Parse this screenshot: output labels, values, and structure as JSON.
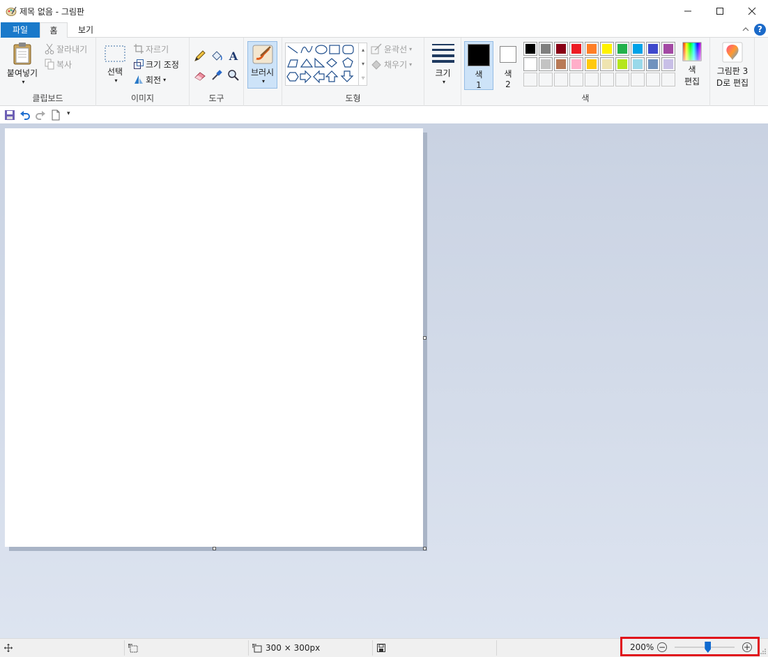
{
  "window": {
    "title": "제목 없음 - 그림판",
    "icon": "paint-palette-icon",
    "controls": [
      "minimize-icon",
      "maximize-icon",
      "close-icon"
    ]
  },
  "tabs": {
    "file": "파일",
    "home": "홈",
    "view": "보기",
    "help": "?"
  },
  "ribbon": {
    "clipboard": {
      "paste": "붙여넣기",
      "cut": "잘라내기",
      "copy": "복사",
      "label": "클립보드"
    },
    "image": {
      "select": "선택",
      "crop": "자르기",
      "resize": "크기 조정",
      "rotate": "회전",
      "label": "이미지"
    },
    "tools": {
      "label": "도구",
      "items": [
        "pencil-icon",
        "fill-bucket-icon",
        "text-icon",
        "eraser-icon",
        "color-picker-icon",
        "magnifier-icon"
      ]
    },
    "brushes": {
      "label": "브러시"
    },
    "shapes": {
      "outline": "윤곽선",
      "fill": "채우기",
      "label": "도형"
    },
    "size": {
      "label": "크기"
    },
    "colors": {
      "color1_label": "색",
      "color1_num": "1",
      "color2_label": "색",
      "color2_num": "2",
      "edit_line1": "색",
      "edit_line2": "편집",
      "label": "색",
      "color1": "#000000",
      "color2": "#ffffff",
      "palette_row1": [
        "#000000",
        "#7f7f7f",
        "#880015",
        "#ed1c24",
        "#ff7f27",
        "#fff200",
        "#22b14c",
        "#00a2e8",
        "#3f48cc",
        "#a349a4"
      ],
      "palette_row2": [
        "#ffffff",
        "#c3c3c3",
        "#b97a57",
        "#ffaec9",
        "#ffc90e",
        "#efe4b0",
        "#b5e61d",
        "#99d9ea",
        "#7092be",
        "#c8bfe7"
      ]
    },
    "paint3d": {
      "line1": "그림판 3",
      "line2": "D로 편집"
    }
  },
  "status": {
    "image_size": "300 × 300px",
    "zoom": "200%",
    "zoom_minus": "−",
    "zoom_plus": "+",
    "zoom_level": 0.55
  }
}
